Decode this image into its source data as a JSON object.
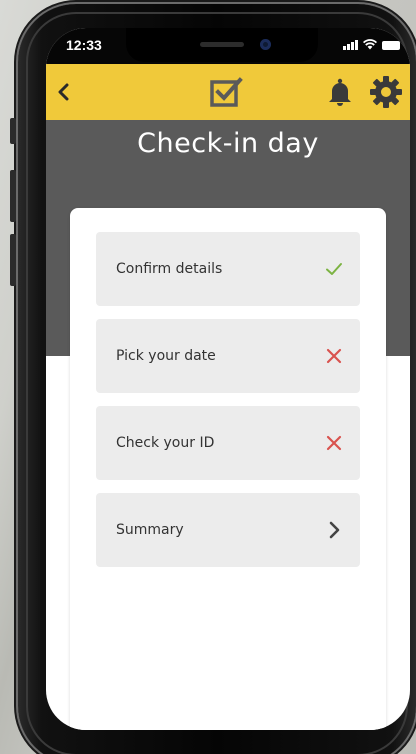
{
  "status_bar": {
    "time": "12:33"
  },
  "app_bar": {
    "back_icon": "chevron-left-icon",
    "center_icon": "checkbox-icon",
    "notification_icon": "bell-icon",
    "settings_icon": "gear-icon"
  },
  "page": {
    "title": "Check-in day"
  },
  "steps": [
    {
      "label": "Confirm details",
      "status": "done",
      "icon": "checkmark-icon"
    },
    {
      "label": "Pick your date",
      "status": "incomplete",
      "icon": "cross-icon"
    },
    {
      "label": "Check your ID",
      "status": "incomplete",
      "icon": "cross-icon"
    },
    {
      "label": "Summary",
      "status": "next",
      "icon": "chevron-right-icon"
    }
  ],
  "colors": {
    "accent_yellow": "#f0c93a",
    "header_gray": "#5a5a5a",
    "row_gray": "#ececec",
    "check_green": "#7cb342",
    "cross_red": "#d9534f",
    "chevron_dark": "#444444"
  }
}
